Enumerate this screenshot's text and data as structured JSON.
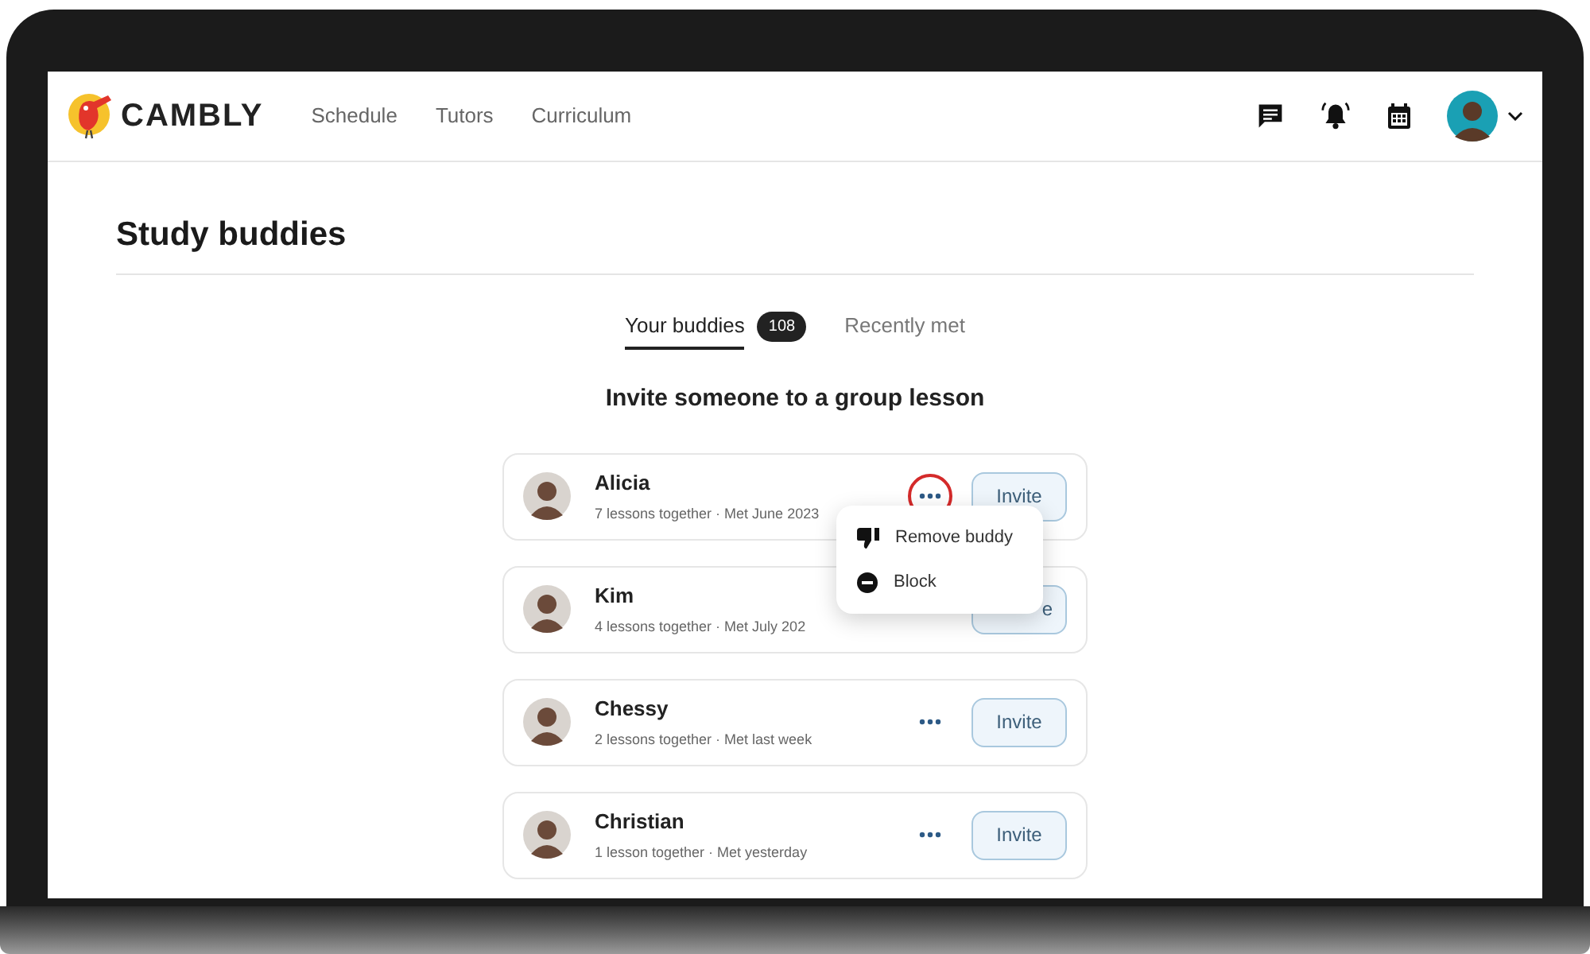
{
  "header": {
    "logo": "CAMBLY",
    "nav": [
      {
        "label": "Schedule"
      },
      {
        "label": "Tutors"
      },
      {
        "label": "Curriculum"
      }
    ]
  },
  "page": {
    "title": "Study buddies"
  },
  "tabs": [
    {
      "label": "Your buddies",
      "count": "108",
      "selected": true
    },
    {
      "label": "Recently met",
      "selected": false
    }
  ],
  "heading": "Invite someone to a group lesson",
  "buddies": [
    {
      "name": "Alicia",
      "meta": "7 lessons together · Met June 2023",
      "invite": "Invite",
      "more": true,
      "highlighted": true
    },
    {
      "name": "Kim",
      "meta": "4 lessons together · Met July 202",
      "invite": "e",
      "more": false
    },
    {
      "name": "Chessy",
      "meta": "2 lessons together · Met last week",
      "invite": "Invite",
      "more": true,
      "highlighted": false
    },
    {
      "name": "Christian",
      "meta": "1 lesson together · Met yesterday",
      "invite": "Invite",
      "more": true,
      "highlighted": false
    }
  ],
  "menu": {
    "items": [
      {
        "kind": "dislike",
        "label": "Remove buddy"
      },
      {
        "kind": "block",
        "label": "Block"
      }
    ]
  }
}
